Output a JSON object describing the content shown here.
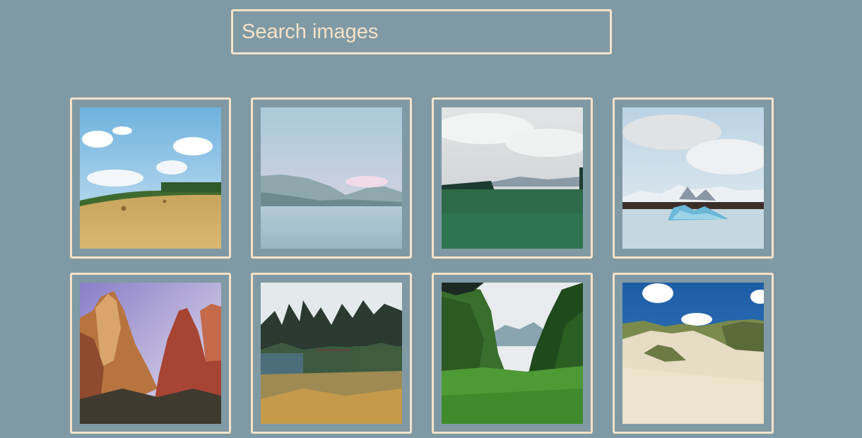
{
  "search": {
    "placeholder": "Search images"
  },
  "colors": {
    "background": "#7f9aa4",
    "accent": "#f6e3c9"
  },
  "gallery": {
    "images": [
      {
        "subject": "wheat-field-hay-bales"
      },
      {
        "subject": "mountain-lake-pastel"
      },
      {
        "subject": "green-meadow-cloudy"
      },
      {
        "subject": "glacier-lagoon-icebergs"
      },
      {
        "subject": "red-rock-canyon-cliffs"
      },
      {
        "subject": "pine-forest-shrubs"
      },
      {
        "subject": "green-valley-trees"
      },
      {
        "subject": "sand-dunes-grass"
      }
    ]
  }
}
